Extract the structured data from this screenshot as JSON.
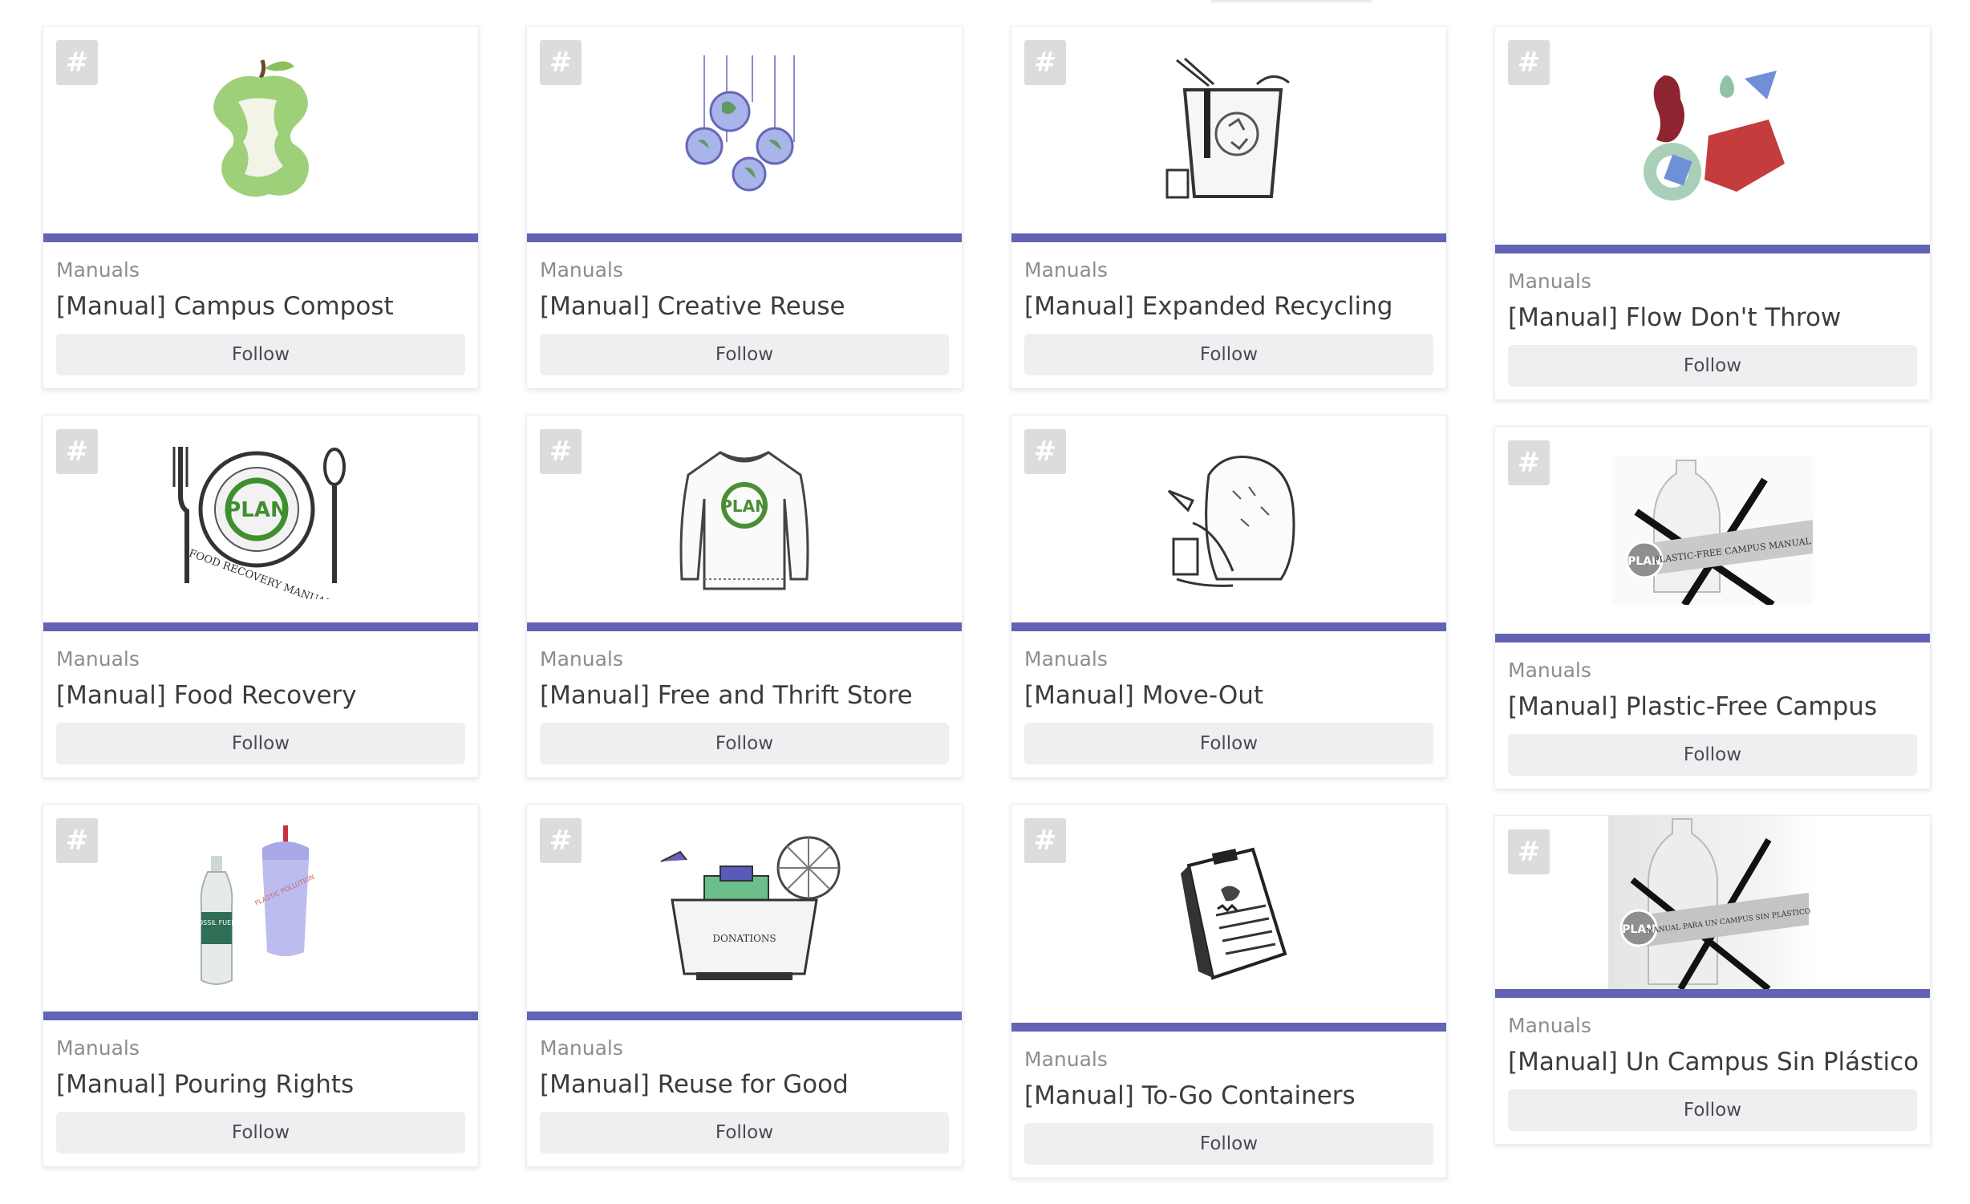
{
  "tag_icon_glyph": "#",
  "accent_color": "#6263b5",
  "columns": [
    [
      {
        "category": "Manuals",
        "title": "[Manual] Campus Compost",
        "follow": "Follow",
        "image": "apple-core-illustration"
      },
      {
        "category": "Manuals",
        "title": "[Manual] Food Recovery",
        "follow": "Follow",
        "image": "plate-fork-spoon-illustration",
        "image_text": "FOOD RECOVERY MANUAL",
        "logo": "PLAN"
      },
      {
        "category": "Manuals",
        "title": "[Manual] Pouring Rights",
        "follow": "Follow",
        "image": "bottle-and-cup-illustration",
        "bottle_text": "FOSSIL FUELS",
        "cup_text": "PLASTIC POLLUTION"
      }
    ],
    [
      {
        "category": "Manuals",
        "title": "[Manual] Creative Reuse",
        "follow": "Follow",
        "image": "hanging-globes-illustration"
      },
      {
        "category": "Manuals",
        "title": "[Manual] Free and Thrift Store",
        "follow": "Follow",
        "image": "sweater-illustration",
        "logo": "PLAN"
      },
      {
        "category": "Manuals",
        "title": "[Manual] Reuse for Good",
        "follow": "Follow",
        "image": "donation-bin-illustration",
        "bin_text": "DONATIONS"
      }
    ],
    [
      {
        "category": "Manuals",
        "title": "[Manual] Expanded Recycling",
        "follow": "Follow",
        "image": "recycling-bin-illustration"
      },
      {
        "category": "Manuals",
        "title": "[Manual] Move-Out",
        "follow": "Follow",
        "image": "armchair-pile-illustration"
      },
      {
        "category": "Manuals",
        "title": "[Manual] To-Go Containers",
        "follow": "Follow",
        "image": "clipboard-illustration"
      }
    ],
    [
      {
        "category": "Manuals",
        "title": "[Manual] Flow Don't Throw",
        "follow": "Follow",
        "image": "menstrual-products-illustration"
      },
      {
        "category": "Manuals",
        "title": "[Manual] Plastic-Free Campus",
        "follow": "Follow",
        "image": "crossed-bottle-illustration",
        "logo": "PLAN",
        "banner_text": "PLASTIC-FREE CAMPUS MANUAL"
      },
      {
        "category": "Manuals",
        "title": "[Manual] Un Campus Sin Plástico",
        "follow": "Follow",
        "image": "crossed-bottle-spanish-illustration",
        "logo": "PLAN",
        "banner_text": "MANUAL PARA UN CAMPUS SIN PLÁSTICO"
      }
    ]
  ]
}
